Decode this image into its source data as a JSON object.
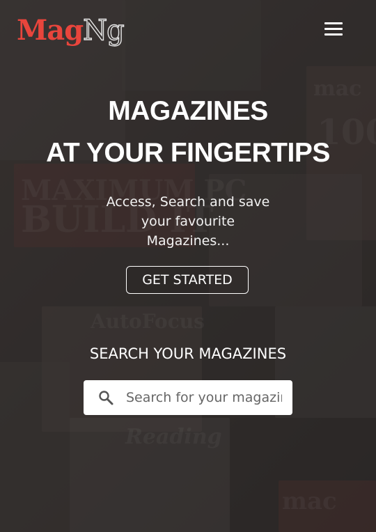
{
  "header": {
    "logo_mag": "Mag",
    "logo_ng": "Ng",
    "menu_icon": "hamburger-menu-icon"
  },
  "hero": {
    "title_line1": "MAGAZINES",
    "title_line2": "AT YOUR FINGERTIPS",
    "description": "Access, Search and save your favourite Magazines...",
    "cta_label": "GET STARTED"
  },
  "search": {
    "title": "SEARCH YOUR MAGAZINES",
    "placeholder": "Search for your magazines",
    "icon": "search-icon"
  },
  "colors": {
    "brand_red": "#e8453c",
    "text": "#ffffff",
    "search_bg": "#ffffff"
  }
}
